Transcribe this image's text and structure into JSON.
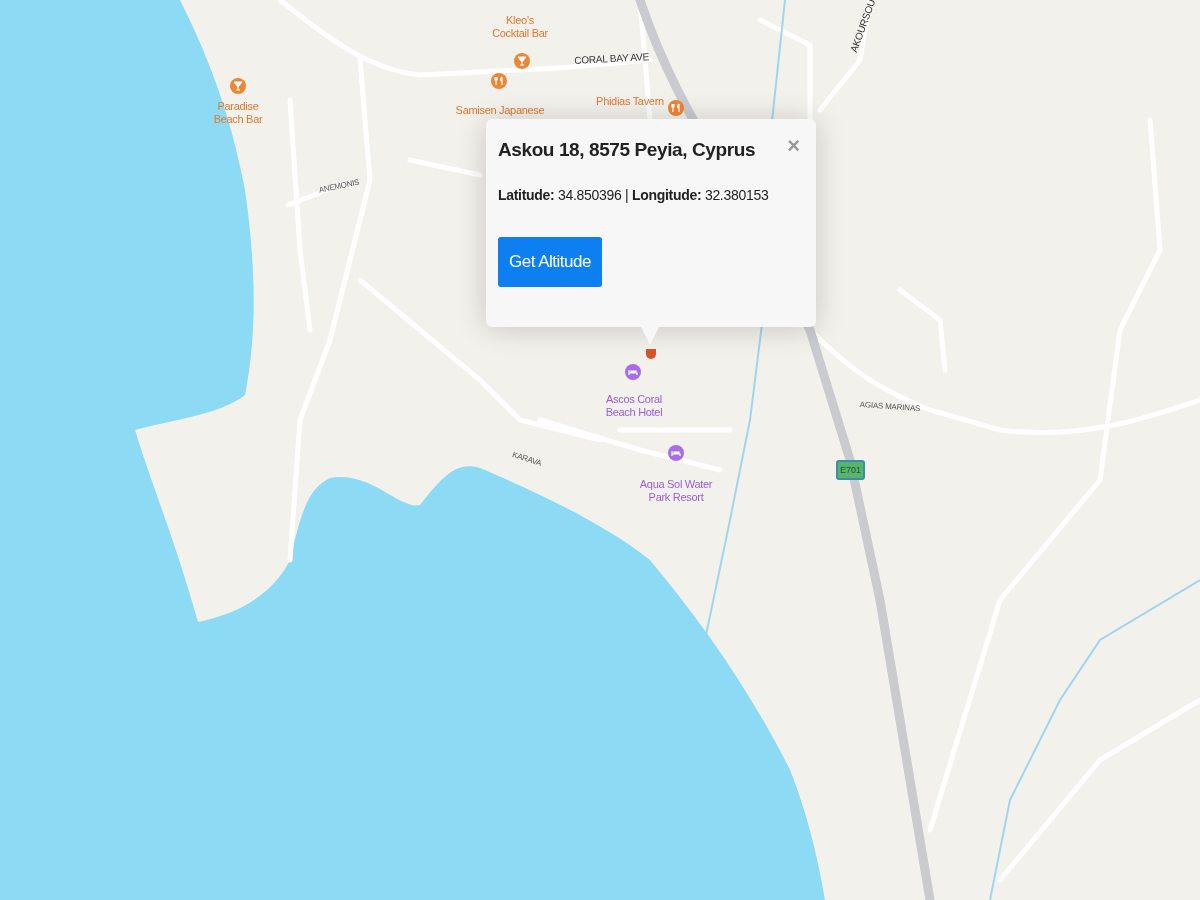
{
  "map": {
    "pois": [
      {
        "name": "Kleo's\nCocktail Bar",
        "kind": "bar"
      },
      {
        "name": "Paradise\nBeach Bar",
        "kind": "bar"
      },
      {
        "name": "Samisen Japanese",
        "kind": "restaurant"
      },
      {
        "name": "Phidias Tavern",
        "kind": "restaurant"
      },
      {
        "name": "Ascos Coral\nBeach Hotel",
        "kind": "hotel"
      },
      {
        "name": "Aqua Sol Water\nPark Resort",
        "kind": "hotel"
      }
    ],
    "roads": [
      {
        "name": "CORAL BAY AVE",
        "kind": "main"
      },
      {
        "name": "AKOURSOU",
        "kind": "main"
      },
      {
        "name": "ANEMONIS",
        "kind": "minor"
      },
      {
        "name": "KARAVA",
        "kind": "minor"
      },
      {
        "name": "AGIAS MARINAS",
        "kind": "minor"
      }
    ],
    "route_shield": "E701"
  },
  "popup": {
    "title": "Askou 18, 8575 Peyia, Cyprus",
    "close": "×",
    "latitude_label": "Latitude:",
    "latitude": "34.850396",
    "separator": "|",
    "longitude_label": "Longitude:",
    "longitude": "32.380153",
    "button": "Get Altitude"
  }
}
